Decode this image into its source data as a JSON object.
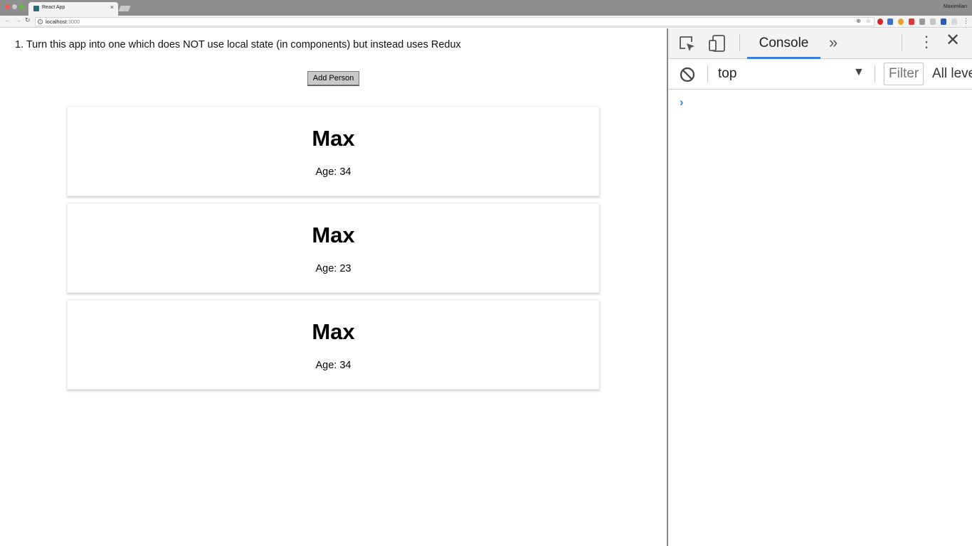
{
  "browser": {
    "tab_title": "React App",
    "tab_close": "×",
    "profile_name": "Maximilian",
    "url_host": "localhost",
    "url_port": ":3000"
  },
  "page": {
    "instruction": "1. Turn this app into one which does NOT use local state (in components) but instead uses Redux",
    "add_button_label": "Add Person",
    "persons": [
      {
        "name": "Max",
        "age": "Age: 34"
      },
      {
        "name": "Max",
        "age": "Age: 23"
      },
      {
        "name": "Max",
        "age": "Age: 34"
      }
    ]
  },
  "devtools": {
    "active_tab": "Console",
    "more_tabs": "»",
    "close": "✕",
    "context": "top",
    "filter_placeholder": "Filter",
    "levels_label": "All levels",
    "prompt": "›",
    "accent_color": "#3b7fe0"
  }
}
